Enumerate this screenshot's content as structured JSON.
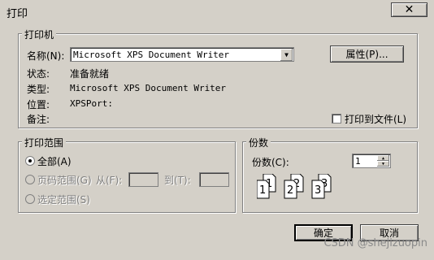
{
  "window": {
    "title": "打印",
    "close_label": "✕"
  },
  "printer": {
    "group_label": "打印机",
    "name_label": "名称(N):",
    "name_value": "Microsoft XPS Document Writer",
    "properties_label": "属性(P)...",
    "status_label": "状态:",
    "status_value": "准备就绪",
    "type_label": "类型:",
    "type_value": "Microsoft XPS Document Writer",
    "where_label": "位置:",
    "where_value": "XPSPort:",
    "comment_label": "备注:",
    "print_to_file_label": "打印到文件(L)",
    "print_to_file_checked": false
  },
  "range": {
    "group_label": "打印范围",
    "all_label": "全部(A)",
    "pages_label": "页码范围(G)",
    "from_label": "从(F):",
    "to_label": "到(T):",
    "selection_label": "选定范围(S)",
    "selected": "all"
  },
  "copies": {
    "group_label": "份数",
    "count_label": "份数(C):",
    "count_value": "1",
    "collate_numbers": [
      "1",
      "1",
      "2",
      "2",
      "3",
      "3"
    ]
  },
  "buttons": {
    "ok_label": "确定",
    "cancel_label": "取消"
  },
  "watermark": "CSDN @shejizuopin"
}
